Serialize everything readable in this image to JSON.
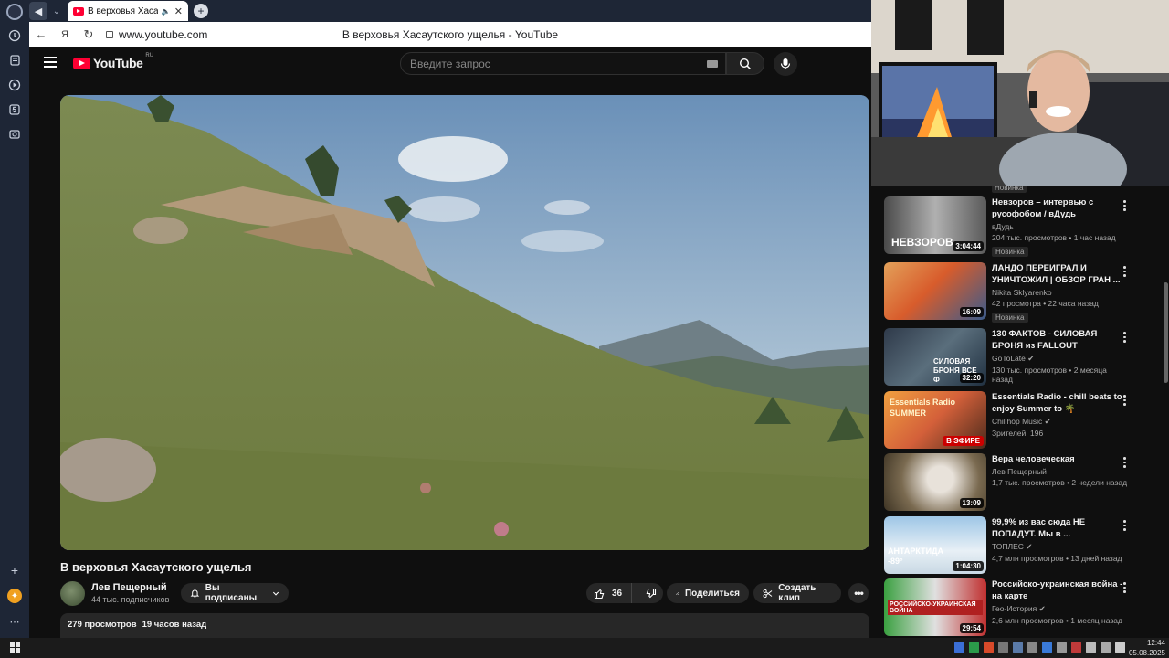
{
  "browser": {
    "tab_title": "В верховья Хасаутского ущелья - YouTube",
    "url": "www.youtube.com",
    "page_title": "В верховья Хасаутского ущелья - YouTube"
  },
  "youtube": {
    "logo_text": "YouTube",
    "country_code": "RU",
    "search_placeholder": "Введите запрос",
    "video_title": "В верховья Хасаутского ущелья",
    "channel_name": "Лев Пещерный",
    "subscribers": "44 тыс. подписчиков",
    "subscribed_label": "Вы подписаны",
    "likes": "36",
    "share_label": "Поделиться",
    "clip_label": "Создать клип",
    "views": "279 просмотров",
    "uploaded": "19 часов назад"
  },
  "sidebar": {
    "top_badge": "Новинка",
    "items": [
      {
        "title": "Невзоров – интервью с русофобом / вДудь",
        "channel": "вДудь",
        "stats": "204 тыс. просмотров • 1 час назад",
        "duration": "3:04:44",
        "badge": "Новинка",
        "thumb_text": "НЕВЗОРОВ"
      },
      {
        "title": "ЛАНДО ПЕРЕИГРАЛ И УНИЧТОЖИЛ | ОБЗОР ГРАН ...",
        "channel": "Nikita Sklyarenko",
        "stats": "42 просмотра • 22 часа назад",
        "duration": "16:09",
        "badge": "Новинка",
        "thumb_text": ""
      },
      {
        "title": "130 ФАКТОВ - СИЛОВАЯ БРОНЯ из FALLOUT",
        "channel": "GoToLate",
        "stats": "130 тыс. просмотров • 2 месяца назад",
        "duration": "32:20",
        "badge": "",
        "thumb_text": "СИЛОВАЯ БРОНЯ ВСЕ Ф"
      },
      {
        "title": "Essentials Radio - chill beats to enjoy Summer to 🌴",
        "channel": "Chillhop Music",
        "stats": "Зрителей: 196",
        "duration": "",
        "live": "В ЭФИРЕ",
        "badge": "",
        "thumb_text": "Essentials Radio SUMMER"
      },
      {
        "title": "Вера человеческая",
        "channel": "Лев Пещерный",
        "stats": "1,7 тыс. просмотров • 2 недели назад",
        "duration": "13:09",
        "badge": "",
        "thumb_text": ""
      },
      {
        "title": "99,9% из вас сюда НЕ ПОПАДУТ. Мы в ...",
        "channel": "ТОПЛЕС",
        "stats": "4,7 млн просмотров • 13 дней назад",
        "duration": "1:04:30",
        "badge": "",
        "thumb_text": "АНТАРКТИДА -89°"
      },
      {
        "title": "Российско-украинская война - на карте",
        "channel": "Гео-История",
        "stats": "2,6 млн просмотров • 1 месяц назад",
        "duration": "29:54",
        "badge": "",
        "thumb_text": "РОССИЙСКО-УКРАИНСКАЯ ВОЙНА"
      }
    ]
  },
  "taskbar": {
    "time": "12:44",
    "date": "05.08.2025"
  },
  "colors": {
    "youtube_red": "#ff0033",
    "background": "#0f0f0f",
    "rail": "#1e2636"
  }
}
